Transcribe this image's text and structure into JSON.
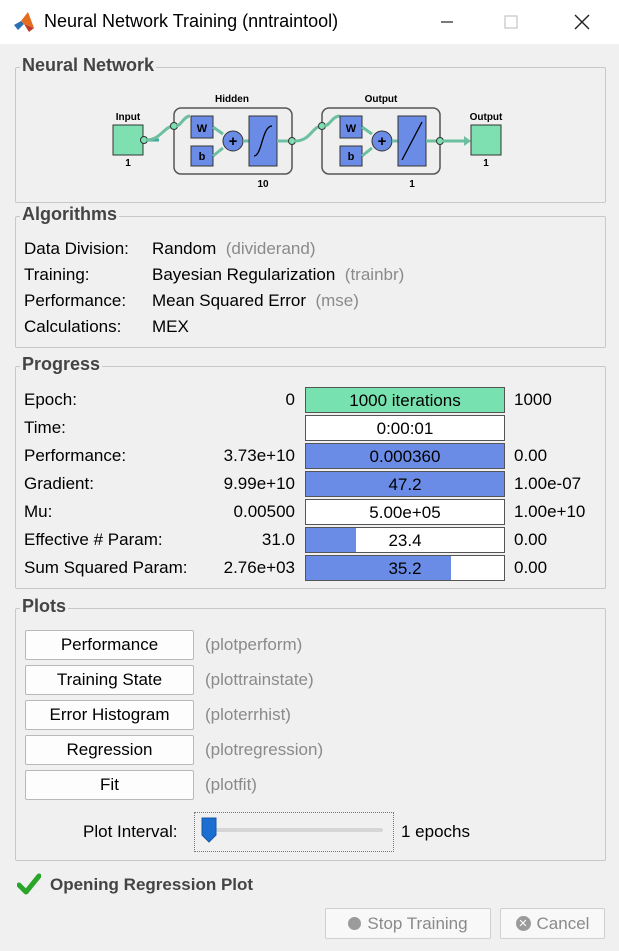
{
  "window": {
    "title": "Neural Network Training (nntraintool)"
  },
  "network": {
    "panel_title": "Neural Network",
    "input_label": "Input",
    "input_size": "1",
    "hidden_label": "Hidden",
    "hidden_size": "10",
    "output_layer_label": "Output",
    "output_layer_size": "1",
    "output_label": "Output",
    "output_size": "1",
    "weight_symbol": "W",
    "bias_symbol": "b"
  },
  "algorithms": {
    "panel_title": "Algorithms",
    "rows": [
      {
        "label": "Data Division:",
        "value": "Random",
        "fn": "(dividerand)"
      },
      {
        "label": "Training:",
        "value": "Bayesian Regularization",
        "fn": "(trainbr)"
      },
      {
        "label": "Performance:",
        "value": "Mean Squared Error",
        "fn": "(mse)"
      },
      {
        "label": "Calculations:",
        "value": "MEX",
        "fn": ""
      }
    ]
  },
  "progress": {
    "panel_title": "Progress",
    "rows": [
      {
        "label": "Epoch:",
        "min": "0",
        "value": "1000 iterations",
        "max": "1000",
        "fill": 1.0,
        "fill_color": "#77e2b0"
      },
      {
        "label": "Time:",
        "min": "",
        "value": "0:00:01",
        "max": "",
        "fill": 0.0,
        "fill_color": "#6b8ce6"
      },
      {
        "label": "Performance:",
        "min": "3.73e+10",
        "value": "0.000360",
        "max": "0.00",
        "fill": 1.0,
        "fill_color": "#6b8ce6"
      },
      {
        "label": "Gradient:",
        "min": "9.99e+10",
        "value": "47.2",
        "max": "1.00e-07",
        "fill": 1.0,
        "fill_color": "#6b8ce6"
      },
      {
        "label": "Mu:",
        "min": "0.00500",
        "value": "5.00e+05",
        "max": "1.00e+10",
        "fill": 0.0,
        "fill_color": "#6b8ce6"
      },
      {
        "label": "Effective # Param:",
        "min": "31.0",
        "value": "23.4",
        "max": "0.00",
        "fill": 0.25,
        "fill_color": "#6b8ce6"
      },
      {
        "label": "Sum Squared Param:",
        "min": "2.76e+03",
        "value": "35.2",
        "max": "0.00",
        "fill": 0.73,
        "fill_color": "#6b8ce6"
      }
    ]
  },
  "plots": {
    "panel_title": "Plots",
    "buttons": [
      {
        "label": "Performance",
        "fn": "(plotperform)"
      },
      {
        "label": "Training State",
        "fn": "(plottrainstate)"
      },
      {
        "label": "Error Histogram",
        "fn": "(ploterrhist)"
      },
      {
        "label": "Regression",
        "fn": "(plotregression)"
      },
      {
        "label": "Fit",
        "fn": "(plotfit)"
      }
    ],
    "interval_label": "Plot Interval:",
    "interval_value": "1 epochs",
    "interval_level": 0.0
  },
  "status": {
    "message": "Opening Regression Plot",
    "icon": "checkmark-icon",
    "icon_color": "#2aa52a"
  },
  "actions": {
    "stop_label": "Stop Training",
    "cancel_label": "Cancel"
  }
}
